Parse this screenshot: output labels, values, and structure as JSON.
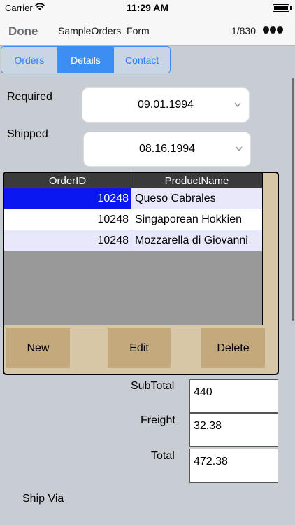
{
  "status": {
    "carrier": "Carrier",
    "time": "11:29 AM",
    "battery_level": 1.0
  },
  "nav": {
    "done": "Done",
    "title": "SampleOrders_Form",
    "record_position": "1/830"
  },
  "tabs": [
    {
      "label": "Orders",
      "active": false
    },
    {
      "label": "Details",
      "active": true
    },
    {
      "label": "Contact",
      "active": false
    }
  ],
  "form": {
    "required_label": "Required",
    "required_value": "09.01.1994",
    "shipped_label": "Shipped",
    "shipped_value": "08.16.1994"
  },
  "grid": {
    "columns": [
      "OrderID",
      "ProductName"
    ],
    "rows": [
      {
        "order_id": "10248",
        "product": "Queso Cabrales"
      },
      {
        "order_id": "10248",
        "product": "Singaporean Hokkien"
      },
      {
        "order_id": "10248",
        "product": "Mozzarella di Giovanni"
      }
    ],
    "selected_row": 0
  },
  "buttons": {
    "new": "New",
    "edit": "Edit",
    "delete": "Delete"
  },
  "totals": {
    "subtotal_label": "SubTotal",
    "subtotal_value": "440",
    "freight_label": "Freight",
    "freight_value": "32.38",
    "total_label": "Total",
    "total_value": "472.38"
  },
  "ship_via_label": "Ship Via",
  "colors": {
    "accent": "#3b8ff3",
    "selected_cell": "#0a17f0",
    "panel": "#d8c7a6",
    "button": "#c4a97c",
    "background": "#c8ccd3"
  }
}
